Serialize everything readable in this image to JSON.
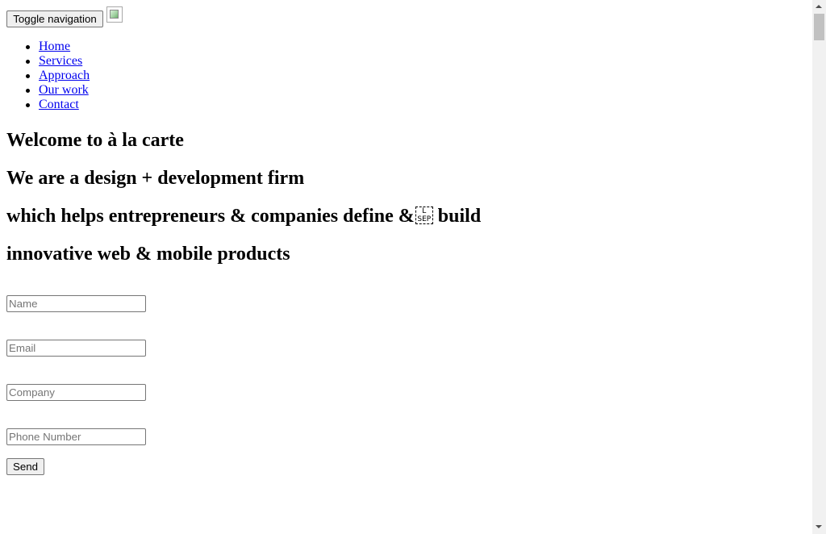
{
  "header": {
    "toggle_label": "Toggle navigation",
    "logo_icon": "broken-image-icon"
  },
  "nav": {
    "items": [
      {
        "label": "Home"
      },
      {
        "label": "Services"
      },
      {
        "label": "Approach"
      },
      {
        "label": "Our work"
      },
      {
        "label": "Contact"
      }
    ]
  },
  "hero": {
    "line1": "Welcome to à la carte",
    "line2": "We are a design + development firm",
    "line3_before": "which helps entrepreneurs & companies define &",
    "line3_sep_top": "L",
    "line3_sep_bottom": "SEP",
    "line3_after": " build",
    "line4": "innovative web & mobile products"
  },
  "form": {
    "name_placeholder": "Name",
    "email_placeholder": "Email",
    "company_placeholder": "Company",
    "phone_placeholder": "Phone Number",
    "send_label": "Send"
  },
  "colors": {
    "link": "#0000ee",
    "text": "#000000",
    "placeholder": "#757575"
  }
}
